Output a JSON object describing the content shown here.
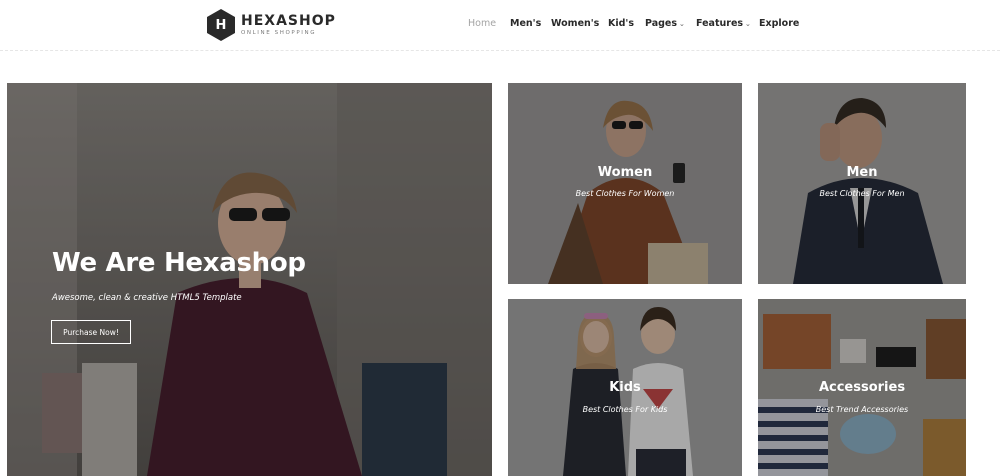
{
  "brand": {
    "logo_letter": "H",
    "name": "HEXASHOP",
    "tagline": "ONLINE SHOPPING"
  },
  "nav": {
    "items": [
      {
        "label": "Home",
        "active": true
      },
      {
        "label": "Men's"
      },
      {
        "label": "Women's"
      },
      {
        "label": "Kid's"
      },
      {
        "label": "Pages",
        "dropdown": true
      },
      {
        "label": "Features",
        "dropdown": true
      },
      {
        "label": "Explore"
      }
    ]
  },
  "hero": {
    "title": "We Are Hexashop",
    "subtitle": "Awesome, clean & creative HTML5 Template",
    "button_label": "Purchase Now!"
  },
  "categories": [
    {
      "title": "Women",
      "subtitle": "Best Clothes For Women"
    },
    {
      "title": "Men",
      "subtitle": "Best Clothes For Men"
    },
    {
      "title": "Kids",
      "subtitle": "Best Clothes For Kids"
    },
    {
      "title": "Accessories",
      "subtitle": "Best Trend Accessories"
    }
  ],
  "icons": {
    "dropdown": "chevron-down-icon",
    "logo": "hexagon-logo-icon"
  },
  "colors": {
    "text_dark": "#2a2a2a",
    "nav_active": "#a4a4a4",
    "overlay": "rgba(0,0,0,0.35)",
    "white": "#ffffff"
  }
}
